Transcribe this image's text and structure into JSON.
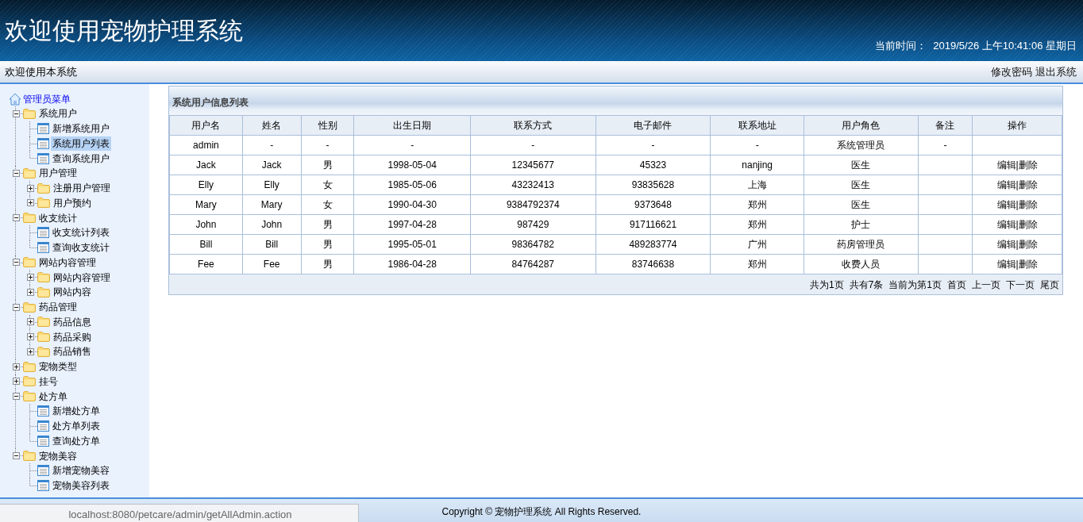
{
  "header": {
    "title": "欢迎使用宠物护理系统",
    "time_label": "当前时间：",
    "time_value": "2019/5/26 上午10:41:06 星期日"
  },
  "topbar": {
    "welcome": "欢迎使用本系统",
    "links": [
      "修改密码",
      "退出系统"
    ]
  },
  "menu": {
    "title": "管理员菜单",
    "items": [
      {
        "label": "系统用户",
        "kind": "folder",
        "expanded": true,
        "selected": false,
        "children": [
          {
            "label": "新增系统用户",
            "kind": "page",
            "selected": false
          },
          {
            "label": "系统用户列表",
            "kind": "page",
            "selected": true
          },
          {
            "label": "查询系统用户",
            "kind": "page",
            "selected": false
          }
        ]
      },
      {
        "label": "用户管理",
        "kind": "folder",
        "expanded": true,
        "selected": false,
        "children": [
          {
            "label": "注册用户管理",
            "kind": "folder",
            "expanded": false,
            "selected": false
          },
          {
            "label": "用户预约",
            "kind": "folder",
            "expanded": false,
            "selected": false
          }
        ]
      },
      {
        "label": "收支统计",
        "kind": "folder",
        "expanded": true,
        "selected": false,
        "children": [
          {
            "label": "收支统计列表",
            "kind": "page",
            "selected": false
          },
          {
            "label": "查询收支统计",
            "kind": "page",
            "selected": false
          }
        ]
      },
      {
        "label": "网站内容管理",
        "kind": "folder",
        "expanded": true,
        "selected": false,
        "children": [
          {
            "label": "网站内容管理",
            "kind": "folder",
            "expanded": false,
            "selected": false
          },
          {
            "label": "网站内容",
            "kind": "folder",
            "expanded": false,
            "selected": false
          }
        ]
      },
      {
        "label": "药品管理",
        "kind": "folder",
        "expanded": true,
        "selected": false,
        "children": [
          {
            "label": "药品信息",
            "kind": "folder",
            "expanded": false,
            "selected": false
          },
          {
            "label": "药品采购",
            "kind": "folder",
            "expanded": false,
            "selected": false
          },
          {
            "label": "药品销售",
            "kind": "folder",
            "expanded": false,
            "selected": false
          }
        ]
      },
      {
        "label": "宠物类型",
        "kind": "folder",
        "expanded": false,
        "selected": false
      },
      {
        "label": "挂号",
        "kind": "folder",
        "expanded": false,
        "selected": false
      },
      {
        "label": "处方单",
        "kind": "folder",
        "expanded": true,
        "selected": false,
        "children": [
          {
            "label": "新增处方单",
            "kind": "page",
            "selected": false
          },
          {
            "label": "处方单列表",
            "kind": "page",
            "selected": false
          },
          {
            "label": "查询处方单",
            "kind": "page",
            "selected": false
          }
        ]
      },
      {
        "label": "宠物美容",
        "kind": "folder",
        "expanded": true,
        "selected": false,
        "children": [
          {
            "label": "新增宠物美容",
            "kind": "page",
            "selected": false
          },
          {
            "label": "宠物美容列表",
            "kind": "page",
            "selected": false
          }
        ]
      }
    ]
  },
  "panel": {
    "title": "系统用户信息列表"
  },
  "table": {
    "columns": [
      "用户名",
      "姓名",
      "性别",
      "出生日期",
      "联系方式",
      "电子邮件",
      "联系地址",
      "用户角色",
      "备注",
      "操作"
    ],
    "action_separator": "|",
    "rows": [
      {
        "cells": [
          "admin",
          "-",
          "-",
          "-",
          "-",
          "-",
          "-",
          "系统管理员",
          "-"
        ]
      },
      {
        "cells": [
          "Jack",
          "Jack",
          "男",
          "1998-05-04",
          "12345677",
          "45323",
          "nanjing",
          "医生",
          ""
        ],
        "actions": [
          "编辑",
          "删除"
        ]
      },
      {
        "cells": [
          "Elly",
          "Elly",
          "女",
          "1985-05-06",
          "43232413",
          "93835628",
          "上海",
          "医生",
          ""
        ],
        "actions": [
          "编辑",
          "删除"
        ]
      },
      {
        "cells": [
          "Mary",
          "Mary",
          "女",
          "1990-04-30",
          "9384792374",
          "9373648",
          "郑州",
          "医生",
          ""
        ],
        "actions": [
          "编辑",
          "删除"
        ]
      },
      {
        "cells": [
          "John",
          "John",
          "男",
          "1997-04-28",
          "987429",
          "917116621",
          "郑州",
          "护士",
          ""
        ],
        "actions": [
          "编辑",
          "删除"
        ]
      },
      {
        "cells": [
          "Bill",
          "Bill",
          "男",
          "1995-05-01",
          "98364782",
          "489283774",
          "广州",
          "药房管理员",
          ""
        ],
        "actions": [
          "编辑",
          "删除"
        ]
      },
      {
        "cells": [
          "Fee",
          "Fee",
          "男",
          "1986-04-28",
          "84764287",
          "83746638",
          "郑州",
          "收费人员",
          ""
        ],
        "actions": [
          "编辑",
          "删除"
        ]
      }
    ]
  },
  "pager": {
    "info": [
      "共为1页",
      "共有7条",
      "当前为第1页"
    ],
    "links": [
      "首页",
      "上一页",
      "下一页",
      "尾页"
    ]
  },
  "footer": {
    "copyright": "Copyright © 宠物护理系统 All Rights Reserved."
  },
  "status_bar": {
    "url": "localhost:8080/petcare/admin/getAllAdmin.action"
  }
}
